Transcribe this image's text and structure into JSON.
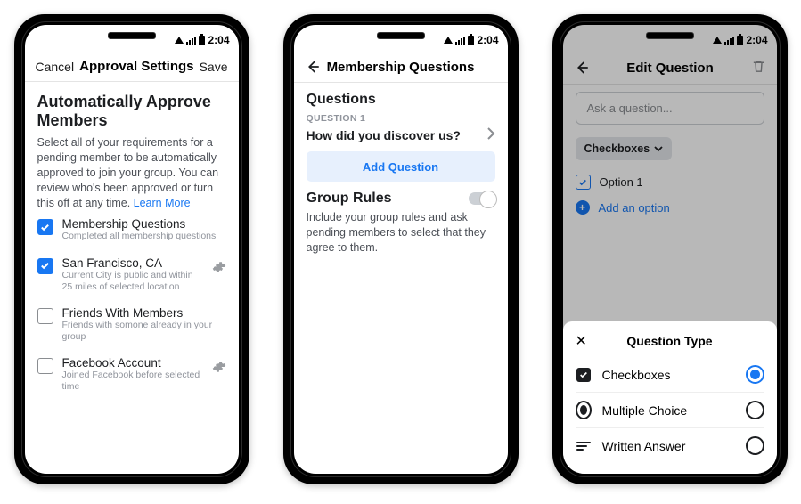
{
  "status": {
    "time": "2:04"
  },
  "phone1": {
    "cancel": "Cancel",
    "title": "Approval Settings",
    "save": "Save",
    "heading": "Automatically Approve Members",
    "desc": "Select all of your requirements for a pending member to be automatically approved to join your group. You can review who's been approved or turn this off at any time. ",
    "learn": "Learn More",
    "items": [
      {
        "title": "Membership Questions",
        "sub": "Completed all membership questions",
        "checked": true,
        "gear": false
      },
      {
        "title": "San Francisco, CA",
        "sub": "Current City is public and within 25 miles of selected location",
        "checked": true,
        "gear": true
      },
      {
        "title": "Friends With Members",
        "sub": "Friends with somone already in your group",
        "checked": false,
        "gear": false
      },
      {
        "title": "Facebook Account",
        "sub": "Joined Facebook before selected time",
        "checked": false,
        "gear": true
      }
    ]
  },
  "phone2": {
    "title": "Membership Questions",
    "sec1": "Questions",
    "qlabel": "QUESTION 1",
    "qtext": "How did you discover us?",
    "add": "Add Question",
    "sec2": "Group Rules",
    "sec2desc": "Include your group rules and ask pending members to select that they agree to them."
  },
  "phone3": {
    "title": "Edit Question",
    "placeholder": "Ask a question...",
    "type_pill": "Checkboxes",
    "opt1": "Option 1",
    "add_opt": "Add an option",
    "sheet": {
      "title": "Question Type",
      "rows": [
        {
          "label": "Checkboxes",
          "selected": true
        },
        {
          "label": "Multiple Choice",
          "selected": false
        },
        {
          "label": "Written Answer",
          "selected": false
        }
      ]
    }
  }
}
